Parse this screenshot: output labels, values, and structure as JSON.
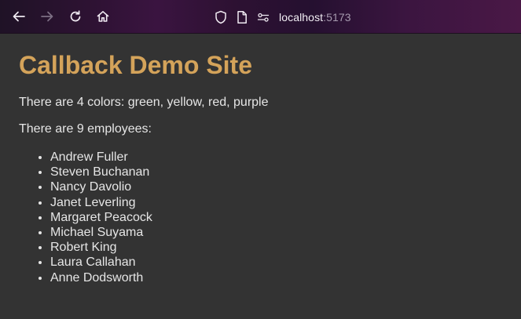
{
  "browser": {
    "url_host": "localhost",
    "url_port": ":5173",
    "icons": [
      "back-arrow-icon",
      "forward-arrow-icon",
      "reload-icon",
      "home-icon",
      "shield-icon",
      "page-icon",
      "site-permissions-icon"
    ]
  },
  "page": {
    "title": "Callback Demo Site",
    "colors_text": "There are 4 colors: green, yellow, red, purple",
    "employees_text": "There are 9 employees:",
    "employees": [
      "Andrew Fuller",
      "Steven Buchanan",
      "Nancy Davolio",
      "Janet Leverling",
      "Margaret Peacock",
      "Michael Suyama",
      "Robert King",
      "Laura Callahan",
      "Anne Dodsworth"
    ]
  },
  "theme": {
    "heading_color": "#d4a35a",
    "background": "#333333",
    "text_color": "#e6e6e6"
  }
}
